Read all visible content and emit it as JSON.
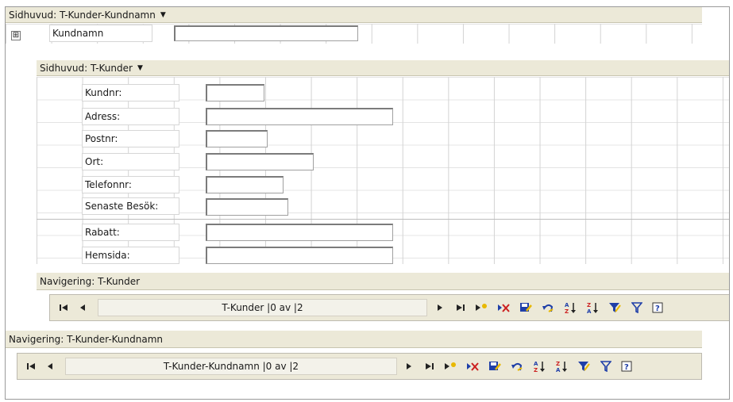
{
  "outer": {
    "header_title": "Sidhuvud: T-Kunder-Kundnamn",
    "expander_symbol": "⊞",
    "kundnamn_label": "Kundnamn",
    "nav_title": "Navigering: T-Kunder-Kundnamn",
    "record_text": "T-Kunder-Kundnamn |0 av |2"
  },
  "inner": {
    "header_title": "Sidhuvud: T-Kunder",
    "nav_title": "Navigering: T-Kunder",
    "record_text": "T-Kunder |0 av |2",
    "fields": [
      {
        "label": "Kundnr:",
        "value": ""
      },
      {
        "label": "Adress:",
        "value": ""
      },
      {
        "label": "Postnr:",
        "value": ""
      },
      {
        "label": "Ort:",
        "value": ""
      },
      {
        "label": "Telefonnr:",
        "value": ""
      },
      {
        "label": "Senaste Besök:",
        "value": ""
      },
      {
        "label": "Rabatt:",
        "value": ""
      },
      {
        "label": "Hemsida:",
        "value": ""
      }
    ]
  },
  "dropdown_glyph": "▼",
  "nav_buttons": {
    "first": "first-record-icon",
    "prev": "previous-record-icon",
    "next": "next-record-icon",
    "last": "last-record-icon",
    "new": "new-record-icon",
    "delete": "delete-record-icon",
    "save": "save-record-icon",
    "undo": "undo-icon",
    "sort_asc": "sort-ascending-icon",
    "sort_desc": "sort-descending-icon",
    "filter_selection": "filter-by-selection-icon",
    "toggle_filter": "toggle-filter-icon",
    "help": "help-icon"
  },
  "colors": {
    "band": "#ece9d8",
    "icon_blue": "#1f3fa8",
    "icon_red": "#cc1f1f",
    "icon_yellow": "#e8b800",
    "icon_green": "#2e8b2e"
  }
}
